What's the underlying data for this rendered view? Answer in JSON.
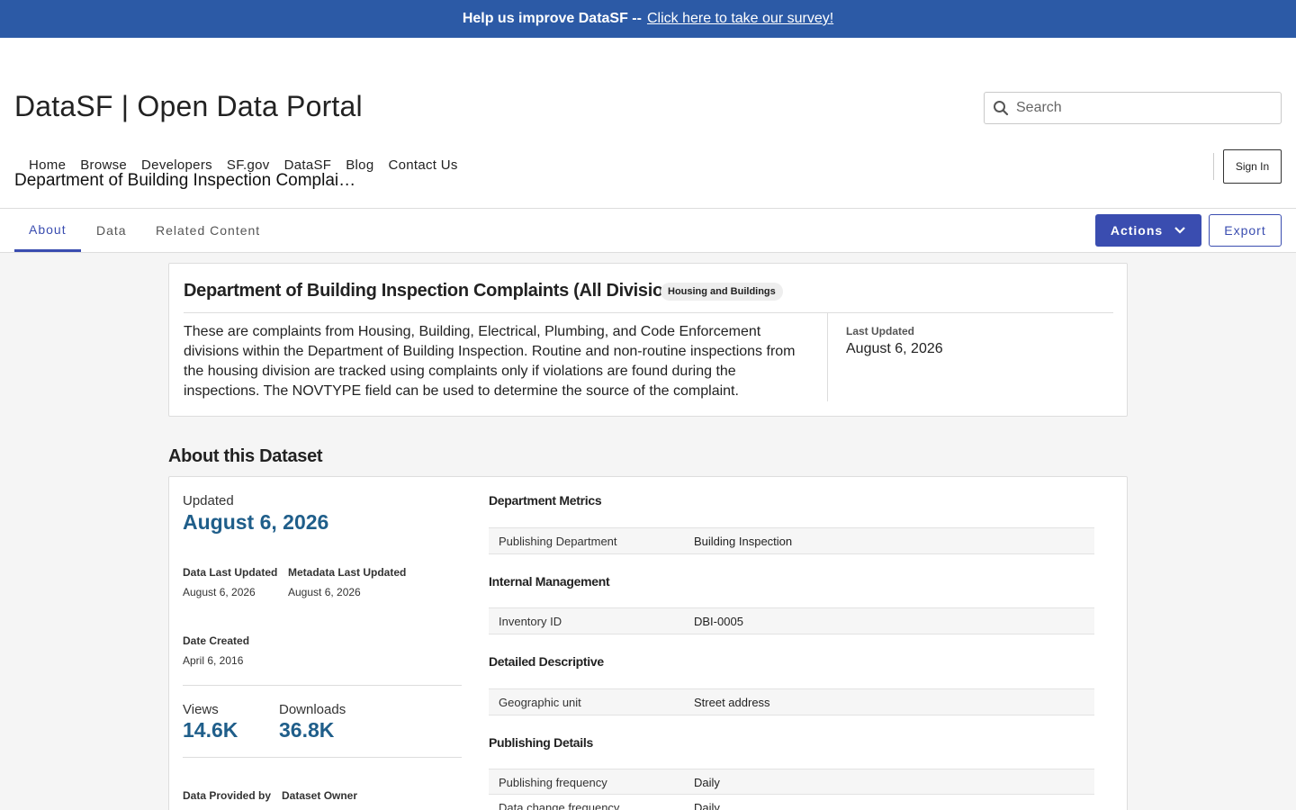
{
  "banner": {
    "text": "Help us improve DataSF --",
    "link": "Click here to take our survey!"
  },
  "header": {
    "site_title": "DataSF | Open Data Portal",
    "search_placeholder": "Search",
    "nav": [
      "Home",
      "Browse",
      "Developers",
      "SF.gov",
      "DataSF",
      "Blog",
      "Contact Us"
    ],
    "sign_in": "Sign In"
  },
  "page_heading": "Department of Building Inspection Complai…",
  "tabs": [
    "About",
    "Data",
    "Related Content"
  ],
  "active_tab": "About",
  "buttons": {
    "actions": "Actions",
    "export": "Export"
  },
  "dataset": {
    "title": "Department of Building Inspection Complaints (All Divisions)",
    "category": "Housing and Buildings",
    "description": "These are complaints from Housing, Building, Electrical, Plumbing, and Code Enforcement divisions within the Department of Building Inspection. Routine and non-routine inspections from the housing division are tracked using complaints only if violations are found during the inspections. The NOVTYPE field can be used to determine the source of the complaint.",
    "last_updated_label": "Last Updated",
    "last_updated": "August 6, 2026"
  },
  "about": {
    "heading": "About this Dataset",
    "updated_label": "Updated",
    "updated_value": "August 6, 2026",
    "data_last_updated_label": "Data Last Updated",
    "data_last_updated": "August 6, 2026",
    "metadata_last_updated_label": "Metadata Last Updated",
    "metadata_last_updated": "August 6, 2026",
    "date_created_label": "Date Created",
    "date_created": "April 6, 2016",
    "views_label": "Views",
    "views": "14.6K",
    "downloads_label": "Downloads",
    "downloads": "36.8K",
    "data_provided_by_label": "Data Provided by",
    "dataset_owner_label": "Dataset Owner"
  },
  "metadata": {
    "department_metrics": {
      "title": "Department Metrics",
      "rows": [
        [
          "Publishing Department",
          "Building Inspection"
        ]
      ]
    },
    "internal_management": {
      "title": "Internal Management",
      "rows": [
        [
          "Inventory ID",
          "DBI-0005"
        ]
      ]
    },
    "detailed_descriptive": {
      "title": "Detailed Descriptive",
      "rows": [
        [
          "Geographic unit",
          "Street address"
        ]
      ]
    },
    "publishing_details": {
      "title": "Publishing Details",
      "rows": [
        [
          "Publishing frequency",
          "Daily"
        ],
        [
          "Data change frequency",
          "Daily"
        ]
      ]
    }
  },
  "colors": {
    "banner": "#2c5aa6",
    "accent": "#3a4db0",
    "stat_value": "#1f5e8a"
  }
}
